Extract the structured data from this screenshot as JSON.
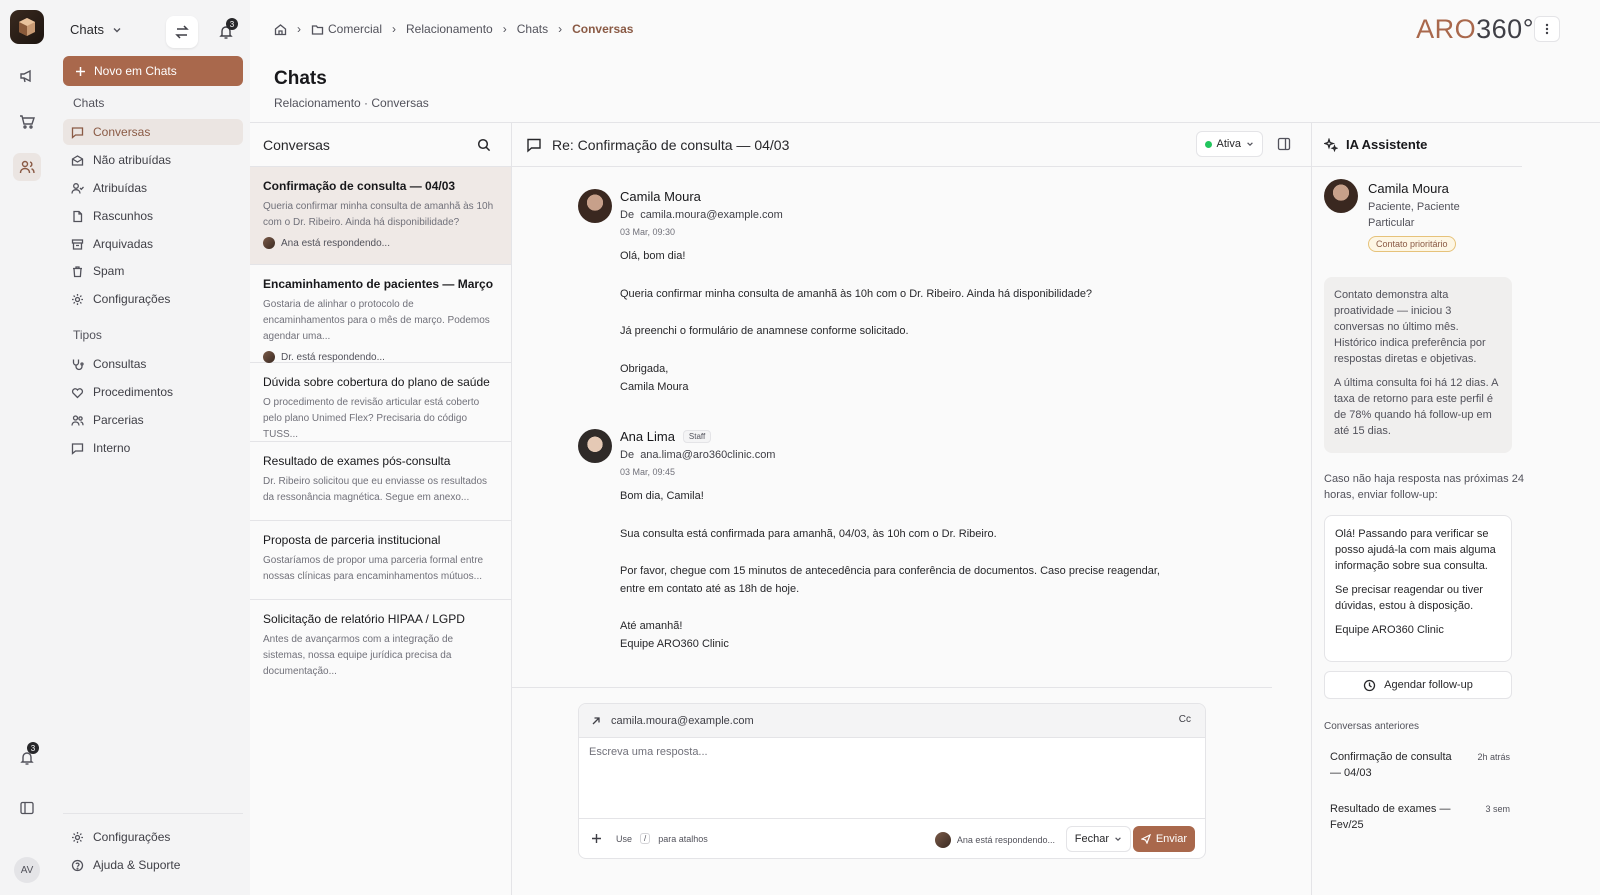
{
  "rail": {
    "bell_badge": "3"
  },
  "sidebar": {
    "workspace": "Chats",
    "bell_badge": "3",
    "new_button": "Novo em Chats",
    "section_chats": "Chats",
    "items": [
      {
        "label": "Conversas"
      },
      {
        "label": "Não atribuídas"
      },
      {
        "label": "Atribuídas"
      },
      {
        "label": "Rascunhos"
      },
      {
        "label": "Arquivadas"
      },
      {
        "label": "Spam"
      },
      {
        "label": "Configurações"
      }
    ],
    "section_types": "Tipos",
    "types": [
      {
        "label": "Consultas"
      },
      {
        "label": "Procedimentos"
      },
      {
        "label": "Parcerias"
      },
      {
        "label": "Interno"
      }
    ],
    "footer": [
      {
        "label": "Configurações"
      },
      {
        "label": "Ajuda & Suporte"
      }
    ],
    "avatar": "AV"
  },
  "header": {
    "crumbs": [
      "Comercial",
      "Relacionamento",
      "Chats",
      "Conversas"
    ],
    "brand_a": "ARO",
    "brand_b": "360°",
    "title": "Chats",
    "subtitle": "Relacionamento · Conversas"
  },
  "list": {
    "title": "Conversas",
    "items": [
      {
        "title": "Confirmação de consulta — 04/03",
        "preview": "Queria confirmar minha consulta de amanhã às 10h com o Dr. Ribeiro. Ainda há disponibilidade?",
        "responding": "Ana está respondendo..."
      },
      {
        "title": "Encaminhamento de pacientes — Março",
        "preview": "Gostaria de alinhar o protocolo de encaminhamentos para o mês de março. Podemos agendar uma...",
        "responding": "Dr. está respondendo..."
      },
      {
        "title": "Dúvida sobre cobertura do plano de saúde",
        "preview": "O procedimento de revisão articular está coberto pelo plano Unimed Flex? Precisaria do código TUSS..."
      },
      {
        "title": "Resultado de exames pós-consulta",
        "preview": "Dr. Ribeiro solicitou que eu enviasse os resultados da ressonância magnética. Segue em anexo..."
      },
      {
        "title": "Proposta de parceria institucional",
        "preview": "Gostaríamos de propor uma parceria formal entre nossas clínicas para encaminhamentos mútuos..."
      },
      {
        "title": "Solicitação de relatório HIPAA / LGPD",
        "preview": "Antes de avançarmos com a integração de sistemas, nossa equipe jurídica precisa da documentação..."
      }
    ]
  },
  "thread": {
    "subject": "Re: Confirmação de consulta — 04/03",
    "status": "Ativa",
    "messages": [
      {
        "name": "Camila Moura",
        "from_label": "De",
        "email": "camila.moura@example.com",
        "date": "03 Mar, 09:30",
        "lines": [
          "Olá, bom dia!",
          "Queria confirmar minha consulta de amanhã às 10h com o Dr. Ribeiro. Ainda há disponibilidade?",
          "Já preenchi o formulário de anamnese conforme solicitado.",
          "Obrigada,",
          "Camila Moura"
        ]
      },
      {
        "name": "Ana Lima",
        "badge": "Staff",
        "from_label": "De",
        "email": "ana.lima@aro360clinic.com",
        "date": "03 Mar, 09:45",
        "lines": [
          "Bom dia, Camila!",
          "Sua consulta está confirmada para amanhã, 04/03, às 10h com o Dr. Ribeiro.",
          "Por favor, chegue com 15 minutos de antecedência para conferência de documentos. Caso precise reagendar,",
          "entre em contato até as 18h de hoje.",
          "Até amanhã!",
          "Equipe ARO360 Clinic"
        ]
      }
    ],
    "compose": {
      "to": "camila.moura@example.com",
      "cc": "Cc",
      "placeholder": "Escreva uma resposta...",
      "hint_use": "Use",
      "hint_key": "/",
      "hint_rest": "para atalhos",
      "typing": "Ana está respondendo...",
      "close": "Fechar",
      "send": "Enviar"
    }
  },
  "ai": {
    "title": "IA Assistente",
    "contact_name": "Camila Moura",
    "contact_role": "Paciente, Paciente Particular",
    "priority": "Contato prioritário",
    "insight_1": "Contato demonstra alta proatividade — iniciou 3 conversas no último mês. Histórico indica preferência por respostas diretas e objetivas.",
    "insight_2": "A última consulta foi há 12 dias. A taxa de retorno para este perfil é de 78% quando há follow-up em até 15 dias.",
    "note": "Caso não haja resposta nas próximas 24 horas, enviar follow-up:",
    "draft_1": "Olá! Passando para verificar se posso ajudá-la com mais alguma informação sobre sua consulta.",
    "draft_2": "Se precisar reagendar ou tiver dúvidas, estou à disposição.",
    "draft_3": "Equipe ARO360 Clinic",
    "schedule_button": "Agendar follow-up",
    "previous_title": "Conversas anteriores",
    "previous": [
      {
        "title": "Confirmação de consulta — 04/03",
        "ago": "2h atrás"
      },
      {
        "title": "Resultado de exames — Fev/25",
        "ago": "3 sem"
      }
    ]
  }
}
